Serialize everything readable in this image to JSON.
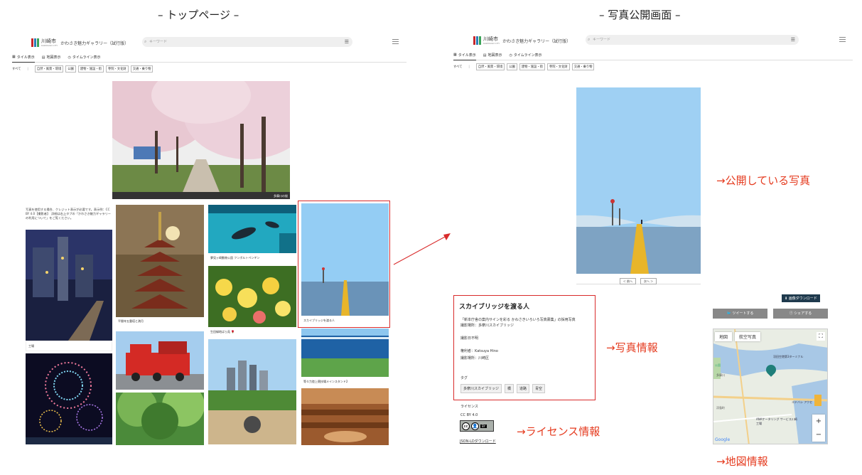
{
  "titles": {
    "top_page": "– トップページ –",
    "photo_page": "– 写真公開画面 –"
  },
  "site": {
    "city": "川崎市",
    "city_sub": "KAWASAKI CITY",
    "gallery": "かわさき魅力ギャラリー（試行版）",
    "search_placeholder": "キーワード",
    "tabs": [
      "タイル表示",
      "地図表示",
      "タイムライン表示"
    ],
    "cat_all": "すべて",
    "cat_sep": "|",
    "categories": [
      "自然・風景・環境",
      "公園",
      "建物・施設・街",
      "寺院・文化財",
      "交通・乗り物"
    ],
    "logo_colors": [
      "#c8262b",
      "#2a7db7",
      "#3aa357"
    ]
  },
  "top": {
    "notice": "写真を使用する場合、クレジット表示が必要です。表示例：CC BY 4.0【撮影者】　詳細は右上タブの「かわさき魅力ギャラリーの利用について」をご覧ください。",
    "hero_caption": "多摩川の桜",
    "captions": {
      "factory": "工場",
      "pagoda": "平間寺五重塔と満月",
      "penguin": "夢見ヶ崎動物公園 フンボルトペンギン",
      "roses": "生田緑地ばら苑 🌹",
      "skybridge": "スカイブリッジを渡る人",
      "stadium": "等々力陸上競技場メインスタンド2"
    }
  },
  "photo": {
    "prev": "＜ 前へ",
    "next": "次へ ＞",
    "title": "スカイブリッジを渡る人",
    "description": "「新本庁舎の案内サインを彩る かわさきいろいろ写真募集」の採用写真",
    "place_label_line": "撮影場所：多摩川スカイブリッジ",
    "date": "撮影日不明",
    "rights": "権利者：Katsuya Hino",
    "place2": "撮影場所：川崎区",
    "tags_label": "タグ",
    "tags": [
      "多摩川スカイブリッジ",
      "橋",
      "道路",
      "青空"
    ],
    "license_label": "ライセンス",
    "license": "CC BY 4.0",
    "cc_badge": "cc",
    "by_badge": "BY",
    "jsonld": "JSON-LDダウンロード",
    "download": "⬇ 画像ダウンロード",
    "tweet": "ツイートする",
    "share": "シェアする",
    "map_tab1": "地図",
    "map_tab2": "航空写真",
    "map_google": "Google",
    "map_plus": "+",
    "map_minus": "−",
    "map_labels": [
      "多摩川",
      "公園",
      "羽田空港第3ターミナル",
      "ANAケータリング サービス川崎工場",
      "ヨドバシ アクセ",
      "浮島町"
    ]
  },
  "annotations": {
    "photo": "→公開している写真",
    "info": "→写真情報",
    "license": "→ライセンス情報",
    "map": "→地図情報"
  },
  "colors": {
    "accent_red": "#e53b1f",
    "box_red": "#d92b2b",
    "dark_button": "#1f3a4d",
    "sky": "#9fd0f3"
  }
}
